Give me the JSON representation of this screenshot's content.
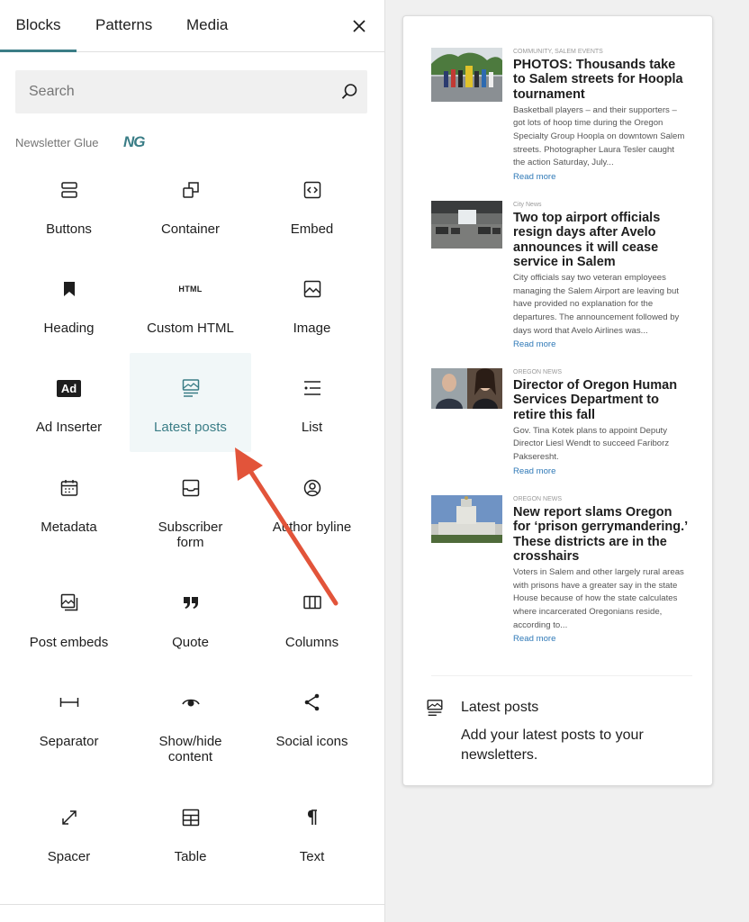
{
  "tabs": [
    {
      "label": "Blocks"
    },
    {
      "label": "Patterns"
    },
    {
      "label": "Media"
    }
  ],
  "search": {
    "placeholder": "Search"
  },
  "group": {
    "title": "Newsletter Glue",
    "logo": "NG"
  },
  "blocks": [
    {
      "label": "Buttons",
      "icon": "buttons-icon"
    },
    {
      "label": "Container",
      "icon": "container-icon"
    },
    {
      "label": "Embed",
      "icon": "embed-icon"
    },
    {
      "label": "Heading",
      "icon": "bookmark-icon"
    },
    {
      "label": "Custom HTML",
      "icon": "html-icon",
      "icon_text": "HTML"
    },
    {
      "label": "Image",
      "icon": "image-icon"
    },
    {
      "label": "Ad Inserter",
      "icon": "ad-icon",
      "icon_text": "Ad"
    },
    {
      "label": "Latest posts",
      "icon": "latest-posts-icon"
    },
    {
      "label": "List",
      "icon": "list-icon"
    },
    {
      "label": "Metadata",
      "icon": "calendar-icon"
    },
    {
      "label": "Subscriber form",
      "icon": "inbox-icon"
    },
    {
      "label": "Author byline",
      "icon": "user-circle-icon"
    },
    {
      "label": "Post embeds",
      "icon": "post-embed-icon"
    },
    {
      "label": "Quote",
      "icon": "quote-icon"
    },
    {
      "label": "Columns",
      "icon": "columns-icon"
    },
    {
      "label": "Separator",
      "icon": "separator-icon"
    },
    {
      "label": "Show/hide content",
      "icon": "eye-icon"
    },
    {
      "label": "Social icons",
      "icon": "share-icon"
    },
    {
      "label": "Spacer",
      "icon": "resize-arrows-icon"
    },
    {
      "label": "Table",
      "icon": "table-icon"
    },
    {
      "label": "Text",
      "icon": "paragraph-icon"
    }
  ],
  "selected_block": "Latest posts",
  "colors": {
    "accent": "#3a7d86",
    "arrow": "#e2543a",
    "link": "#2f79b7"
  },
  "preview": {
    "posts": [
      {
        "category": "COMMUNITY, SALEM EVENTS",
        "title": "PHOTOS: Thousands take to Salem streets for Hoopla tournament",
        "excerpt": "Basketball players – and their supporters – got lots of hoop time during the Oregon Specialty Group Hoopla on downtown Salem streets. Photographer Laura Tesler caught the action Saturday, July...",
        "read_more": "Read more"
      },
      {
        "category": "City News",
        "title": "Two top airport officials resign days after Avelo announces it will cease service in Salem",
        "excerpt": "City officials say two veteran employees managing the Salem Airport are leaving but have provided no explanation for the departures. The announcement followed by days word that Avelo Airlines was...",
        "read_more": "Read more"
      },
      {
        "category": "OREGON NEWS",
        "title": "Director of Oregon Human Services Department to retire this fall",
        "excerpt": "Gov. Tina Kotek plans to appoint Deputy Director Liesl Wendt to succeed Fariborz Pakseresht.",
        "read_more": "Read more"
      },
      {
        "category": "OREGON NEWS",
        "title": "New report slams Oregon for ‘prison gerrymandering.’ These districts are in the crosshairs",
        "excerpt": "Voters in Salem and other largely rural areas with prisons have a greater say in the state House because of how the state calculates where incarcerated Oregonians reside, according to...",
        "read_more": "Read more"
      }
    ],
    "block_title": "Latest posts",
    "block_description": "Add your latest posts to your newsletters."
  }
}
